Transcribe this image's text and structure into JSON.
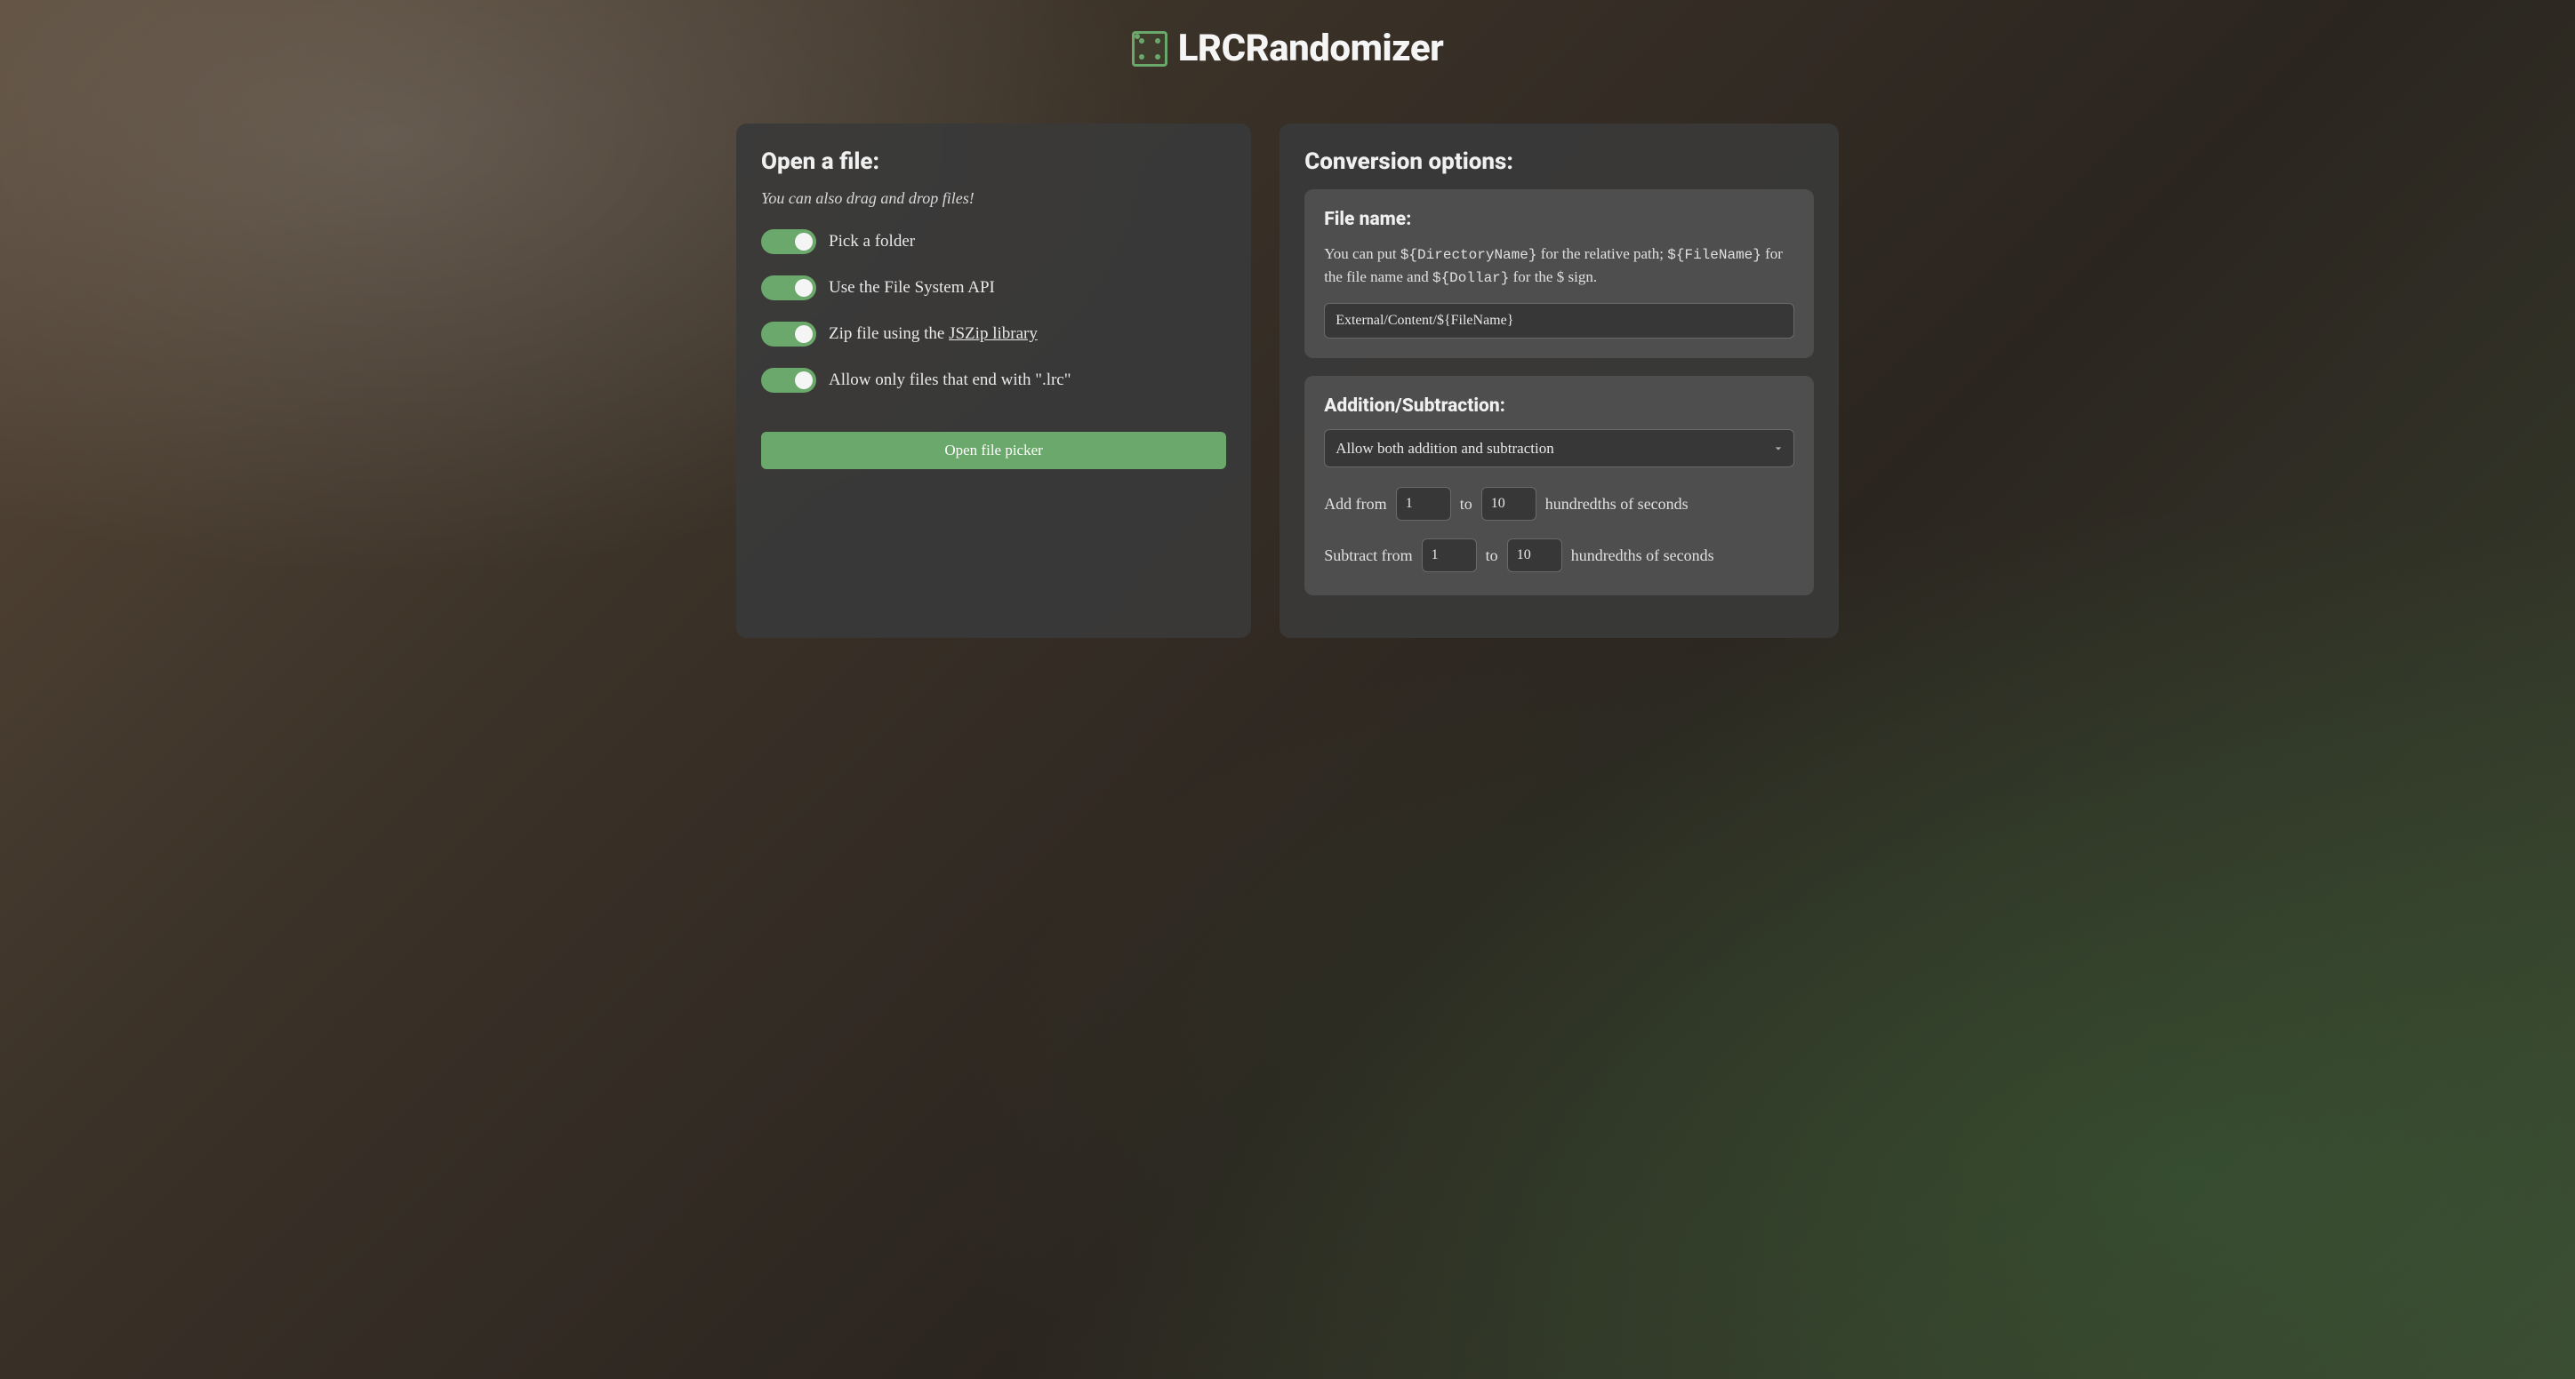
{
  "app": {
    "title": "LRCRandomizer"
  },
  "left_panel": {
    "title": "Open a file:",
    "subtitle": "You can also drag and drop files!",
    "toggles": {
      "pick_folder": "Pick a folder",
      "file_system_api": "Use the File System API",
      "zip_prefix": "Zip file using the ",
      "zip_link": "JSZip library",
      "lrc_only": "Allow only files that end with \".lrc\""
    },
    "button": "Open file picker"
  },
  "right_panel": {
    "title": "Conversion options:",
    "filename": {
      "title": "File name:",
      "help_prefix": "You can put ",
      "help_var1": "${DirectoryName}",
      "help_mid1": " for the relative path; ",
      "help_var2": "${FileName}",
      "help_mid2": " for the file name and ",
      "help_var3": "${Dollar}",
      "help_suffix": " for the $ sign.",
      "value": "External/Content/${FileName}"
    },
    "addsub": {
      "title": "Addition/Subtraction:",
      "select_value": "Allow both addition and subtraction",
      "add_label": "Add from",
      "add_from": "1",
      "to_label": "to",
      "add_to": "10",
      "unit": "hundredths of seconds",
      "sub_label": "Subtract from",
      "sub_from": "1",
      "sub_to": "10"
    }
  }
}
